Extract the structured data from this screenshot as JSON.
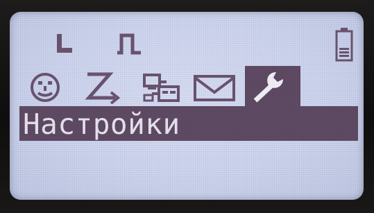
{
  "status_bar": {
    "icons": [
      "signal-low-icon",
      "pulse-icon"
    ],
    "battery": "battery-icon"
  },
  "menu": {
    "icons": [
      "smiley-icon",
      "redial-arrow-icon",
      "network-icon",
      "envelope-icon",
      "wrench-icon"
    ],
    "selected": "wrench-icon"
  },
  "title": {
    "label": "Настройки"
  },
  "colors": {
    "screen_bg": "#cdd4ee",
    "highlight": "#5f4a63",
    "ink": "#6a5470",
    "highlight_text": "#e7e3f1"
  }
}
